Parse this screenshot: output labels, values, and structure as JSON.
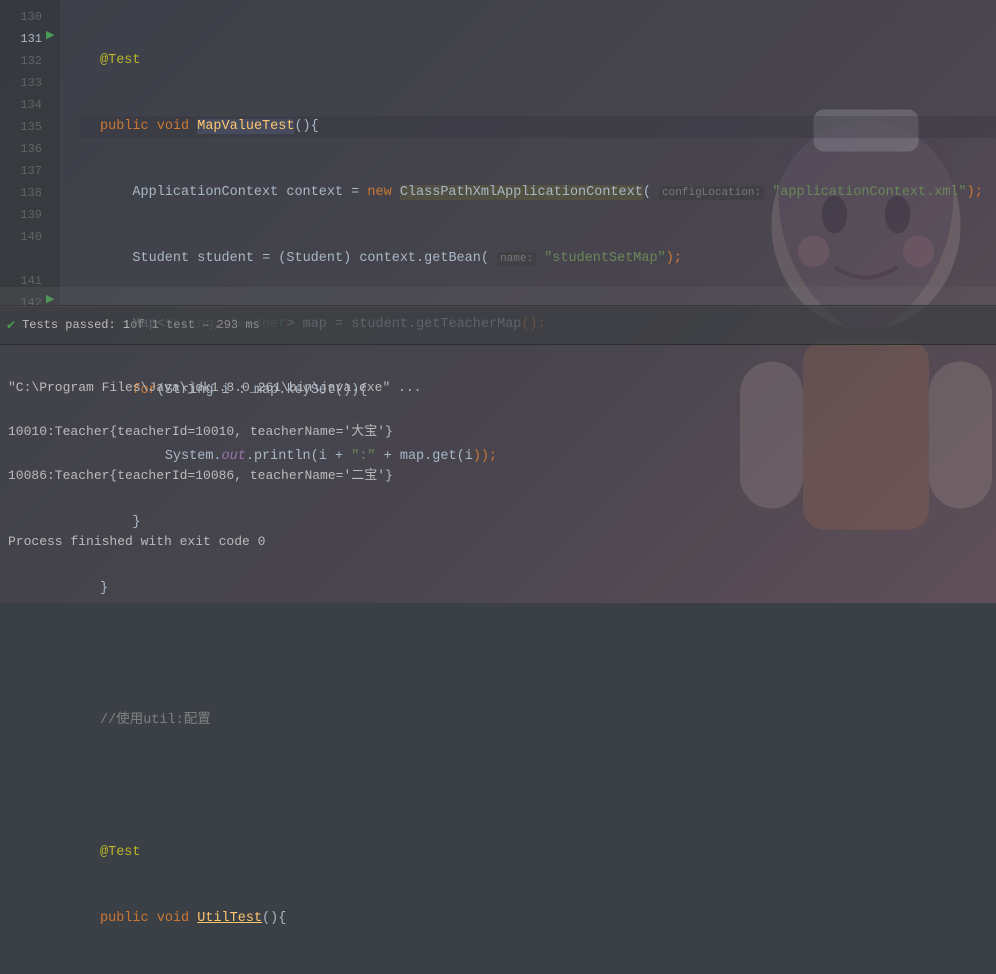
{
  "gutter": {
    "lines": [
      "130",
      "131",
      "132",
      "133",
      "134",
      "135",
      "136",
      "137",
      "138",
      "139",
      "140",
      "",
      "141",
      "142"
    ],
    "currentLine": "131"
  },
  "code": {
    "l130": {
      "annotation": "@Test"
    },
    "l131": {
      "pub": "public",
      "void": "void",
      "method": "MapValueTest",
      "parens": "()",
      "brace": "{"
    },
    "l132": {
      "type1": "ApplicationContext",
      "var1": "context",
      "eq": "=",
      "newkw": "new",
      "ctor": "ClassPathXmlApplicationContext",
      "hint": "configLocation:",
      "str": "\"applicationContext.xml\"",
      "close": ");"
    },
    "l133": {
      "type1": "Student",
      "var1": "student",
      "eq": "=",
      "cast": "(Student)",
      "ctx": "context",
      "dot": ".",
      "m": "getBean",
      "hint": "name:",
      "str": "\"studentSetMap\"",
      "close": ");"
    },
    "l134": {
      "type1": "Map",
      "lt": "<",
      "gp1": "String",
      "comma": ",",
      "gp2": "Teacher",
      "gt": ">",
      "var": "map",
      "eq": "=",
      "obj": "student",
      "dot": ".",
      "m": "getTeacherMap",
      "close": "();"
    },
    "l135": {
      "for": "for",
      "open": "(",
      "type": "String",
      "var": "i",
      "colon": ":",
      "obj": "map",
      "dot": ".",
      "m": "keySet",
      "close": "()){",
      "brace": ""
    },
    "l136": {
      "sys": "System",
      "dot1": ".",
      "out": "out",
      "dot2": ".",
      "m": "println",
      "open": "(",
      "v1": "i",
      "plus1": "+",
      "str": "\":\"",
      "plus2": "+",
      "obj": "map",
      "dot3": ".",
      "m2": "get",
      "open2": "(",
      "v2": "i",
      "close": "));"
    },
    "l137": {
      "brace": "}"
    },
    "l138": {
      "brace": "}"
    },
    "l140": {
      "comment": "//使用util:配置"
    },
    "l141": {
      "annotation": "@Test"
    },
    "l142": {
      "pub": "public",
      "void": "void",
      "method": "UtilTest",
      "parens": "()",
      "brace": "{"
    }
  },
  "testbar": {
    "passed": "Tests passed: 1",
    "rest": " of 1 test – 293 ms"
  },
  "console": {
    "line1": "\"C:\\Program Files\\Java\\jdk1.8.0_261\\bin\\java.exe\" ...",
    "line2": "10010:Teacher{teacherId=10010, teacherName='大宝'}",
    "line3": "10086:Teacher{teacherId=10086, teacherName='二宝'}",
    "line4": "",
    "line5": "Process finished with exit code 0"
  }
}
